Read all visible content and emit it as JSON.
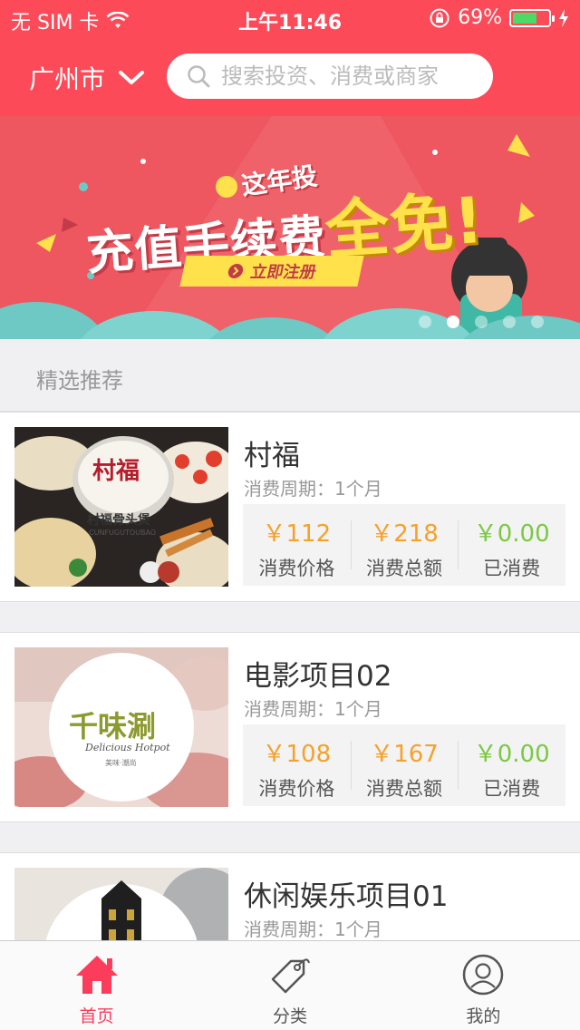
{
  "status_bar": {
    "carrier": "无 SIM 卡",
    "time": "上午11:46",
    "battery": "69%",
    "battery_level": 0.69
  },
  "header": {
    "city": "广州市",
    "search_placeholder": "搜索投资、消费或商家"
  },
  "banner": {
    "subtitle": "这年投",
    "title_prefix": "充值手续费",
    "title_highlight": "全免!",
    "button": "立即注册",
    "pages": 5,
    "active_page": 2
  },
  "section": {
    "title": "精选推荐"
  },
  "items": [
    {
      "name": "村福",
      "period": "消费周期：1个月",
      "price": "￥112",
      "price_label": "消费价格",
      "total": "￥218",
      "total_label": "消费总额",
      "spent": "￥0.00",
      "spent_label": "已消费",
      "thumb_text": "村福",
      "thumb_sub": "村福骨头煲",
      "thumb_en": "CUNFUGUTOUBAO"
    },
    {
      "name": "电影项目02",
      "period": "消费周期：1个月",
      "price": "￥108",
      "price_label": "消费价格",
      "total": "￥167",
      "total_label": "消费总额",
      "spent": "￥0.00",
      "spent_label": "已消费",
      "thumb_text": "千味涮",
      "thumb_en": "Delicious Hotpot",
      "thumb_sub": "美味·潮尚"
    },
    {
      "name": "休闲娱乐项目01",
      "period": "消费周期：1个月"
    }
  ],
  "tabbar": [
    {
      "label": "首页",
      "active": true
    },
    {
      "label": "分类",
      "active": false
    },
    {
      "label": "我的",
      "active": false
    }
  ],
  "colors": {
    "brand": "#fc4a58",
    "price": "#f5a12b",
    "spent": "#7ac943",
    "tab_active": "#fc3c5b"
  }
}
